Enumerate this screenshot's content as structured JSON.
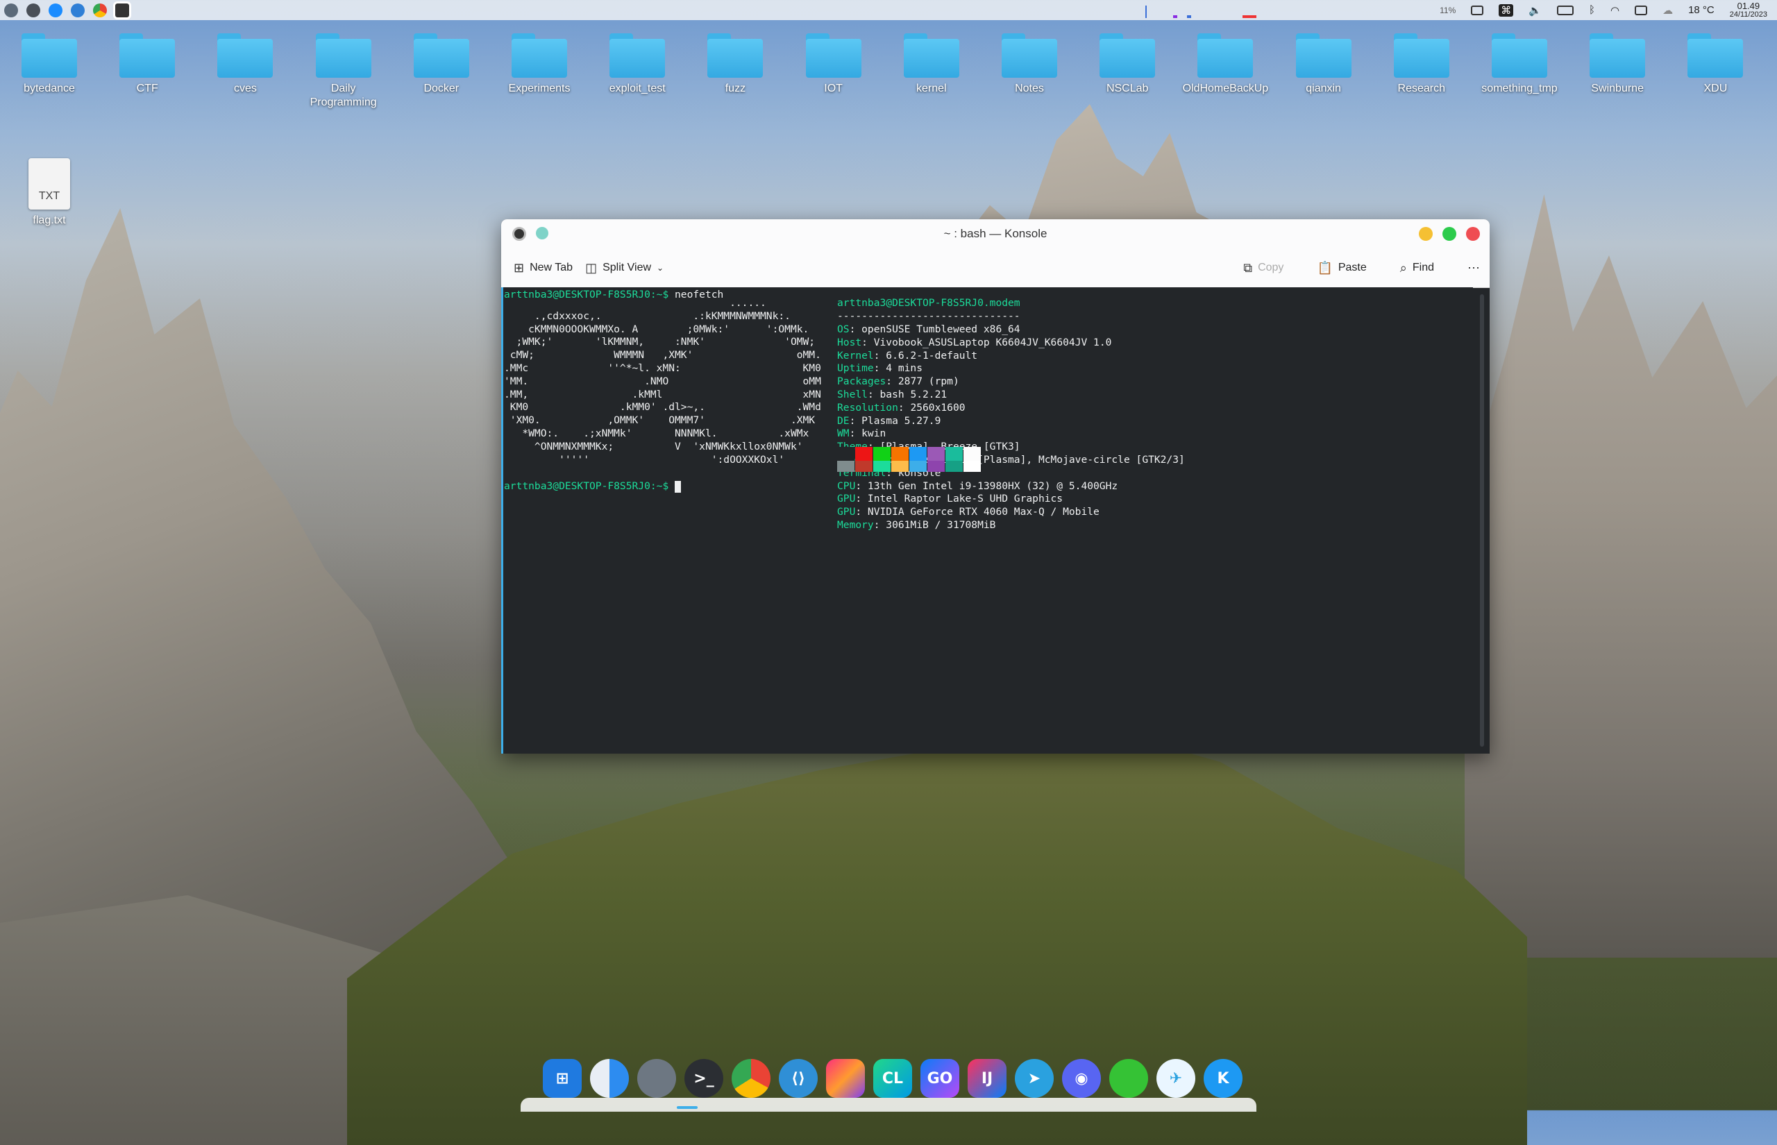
{
  "panel": {
    "tray_cpu": "11%",
    "weather": "18 °C",
    "time": "01.49",
    "date": "24/11/2023"
  },
  "desktop": {
    "folders": [
      "bytedance",
      "CTF",
      "cves",
      "Daily Programming",
      "Docker",
      "Experiments",
      "exploit_test",
      "fuzz",
      "IOT",
      "kernel",
      "Notes",
      "NSCLab",
      "OldHomeBackUp",
      "qianxin",
      "Research",
      "something_tmp",
      "Swinburne",
      "XDU"
    ],
    "file": {
      "name": "flag.txt",
      "badge": "TXT"
    }
  },
  "window": {
    "title": "~ : bash — Konsole",
    "toolbar": {
      "new_tab": "New Tab",
      "split_view": "Split View",
      "copy": "Copy",
      "paste": "Paste",
      "find": "Find"
    }
  },
  "terminal": {
    "prompt1": "arttnba3@DESKTOP-F8S5RJ0:~$",
    "command": " neofetch",
    "ascii": [
      "                                     ......",
      "     .,cdxxxoc,.               .:kKMMMNWMMMNk:.",
      "    cKMMN0OOOKWMMXo. A        ;0MWk:'      ':OMMk.",
      "  ;WMK;'       'lKMMNM,     :NMK'             'OMW;",
      " cMW;             WMMMN   ,XMK'                 oMM.",
      ".MMc             ''^*~l. xMN:                    KM0",
      "'MM.                   .NMO                      oMM",
      ".MM,                 .kMMl                       xMN",
      " KM0               .kMM0' .dl>~,.               .WMd",
      " 'XM0.           ,OMMK'    OMMM7'              .XMK",
      "   *WMO:.    .;xNMMk'       NNNMKl.          .xWMx",
      "     ^ONMMNXMMMKx;          V  'xNMWKkxllox0NMWk'",
      "         '''''                    ':dOOXXKOxl'"
    ],
    "userhost": "arttnba3@DESKTOP-F8S5RJ0.modem",
    "separator": "------------------------------",
    "info": [
      {
        "k": "OS",
        "v": ": openSUSE Tumbleweed x86_64"
      },
      {
        "k": "Host",
        "v": ": Vivobook_ASUSLaptop K6604JV_K6604JV 1.0"
      },
      {
        "k": "Kernel",
        "v": ": 6.6.2-1-default"
      },
      {
        "k": "Uptime",
        "v": ": 4 mins"
      },
      {
        "k": "Packages",
        "v": ": 2877 (rpm)"
      },
      {
        "k": "Shell",
        "v": ": bash 5.2.21"
      },
      {
        "k": "Resolution",
        "v": ": 2560x1600"
      },
      {
        "k": "DE",
        "v": ": Plasma 5.27.9"
      },
      {
        "k": "WM",
        "v": ": kwin"
      },
      {
        "k": "Theme",
        "v": ": [Plasma], Breeze [GTK3]"
      },
      {
        "k": "Icons",
        "v": ": McMojave-circle [Plasma], McMojave-circle [GTK2/3]"
      },
      {
        "k": "Terminal",
        "v": ": konsole"
      },
      {
        "k": "CPU",
        "v": ": 13th Gen Intel i9-13980HX (32) @ 5.400GHz"
      },
      {
        "k": "GPU",
        "v": ": Intel Raptor Lake-S UHD Graphics"
      },
      {
        "k": "GPU",
        "v": ": NVIDIA GeForce RTX 4060 Max-Q / Mobile"
      },
      {
        "k": "Memory",
        "v": ": 3061MiB / 31708MiB"
      }
    ],
    "prompt2": "arttnba3@DESKTOP-F8S5RJ0:~$",
    "palette_top": [
      "#232629",
      "#ed1515",
      "#11d116",
      "#f67400",
      "#1d99f3",
      "#9b59b6",
      "#1abc9c",
      "#fcfcfc"
    ],
    "palette_bottom": [
      "#7f8c8d",
      "#c0392b",
      "#1cdc9a",
      "#fdbc4b",
      "#3daee9",
      "#8e44ad",
      "#16a085",
      "#ffffff"
    ]
  },
  "dock": {
    "apps": [
      "windows",
      "finder",
      "settings",
      "terminal",
      "chrome",
      "vscode",
      "jetbrains-toolbox",
      "clion",
      "goland",
      "intellij",
      "telegram",
      "discord",
      "wechat",
      "feishu",
      "kde-connect"
    ],
    "labels": {
      "clion": "CL",
      "goland": "GO",
      "intellij": "IJ",
      "terminal": ">_",
      "kde": "K"
    }
  }
}
